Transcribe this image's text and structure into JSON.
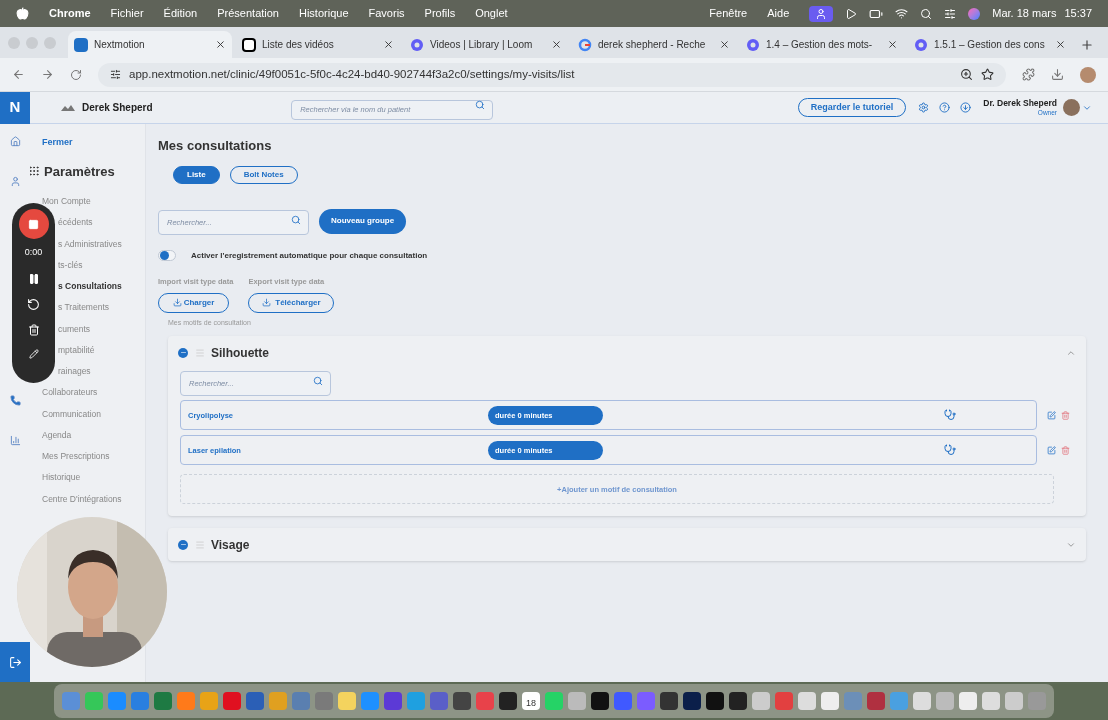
{
  "menu_bar": {
    "app": "Chrome",
    "items": [
      "Fichier",
      "Édition",
      "Présentation",
      "Historique",
      "Favoris",
      "Profils",
      "Onglet"
    ],
    "right_items": [
      "Fenêtre",
      "Aide"
    ],
    "date": "Mar. 18 mars",
    "time": "15:37"
  },
  "tabs": [
    {
      "title": "Nextmotion",
      "selected": true,
      "kind": "n"
    },
    {
      "title": "Liste des vidéos",
      "selected": false,
      "kind": "notion"
    },
    {
      "title": "Videos | Library | Loom",
      "selected": false,
      "kind": "loom"
    },
    {
      "title": "derek shepherd - Reche",
      "selected": false,
      "kind": "google"
    },
    {
      "title": "1.4 – Gestion des mots-",
      "selected": false,
      "kind": "loom"
    },
    {
      "title": "1.5.1 – Gestion des cons",
      "selected": false,
      "kind": "loom"
    }
  ],
  "address_bar": {
    "url": "app.nextmotion.net/clinic/49f0051c-5f0c-4c24-bd40-902744f3a2c0/settings/my-visits/list"
  },
  "app_header": {
    "logo": "N",
    "clinic": "Derek Sheperd",
    "search_placeholder": "Rechercher via le nom du patient",
    "tutorial_button": "Regarder le tutoriel",
    "user_name": "Dr. Derek Sheperd",
    "user_role": "Owner"
  },
  "sidebar": {
    "close": "Fermer",
    "title": "Paramètres",
    "items": [
      {
        "label": "Mon Compte",
        "selected": false
      },
      {
        "label": "écédents",
        "selected": false
      },
      {
        "label": "s Administratives",
        "selected": false
      },
      {
        "label": "ts-clés",
        "selected": false
      },
      {
        "label": "s Consultations",
        "selected": true
      },
      {
        "label": "s Traitements",
        "selected": false
      },
      {
        "label": "cuments",
        "selected": false
      },
      {
        "label": "mptabilité",
        "selected": false
      },
      {
        "label": "rainages",
        "selected": false
      },
      {
        "label": "Collaborateurs",
        "selected": false
      },
      {
        "label": "Communication",
        "selected": false
      },
      {
        "label": "Agenda",
        "selected": false
      },
      {
        "label": "Mes Prescriptions",
        "selected": false
      },
      {
        "label": "Historique",
        "selected": false
      },
      {
        "label": "Centre D'intégrations",
        "selected": false
      }
    ]
  },
  "recorder": {
    "time": "0:00"
  },
  "main": {
    "title": "Mes consultations",
    "view_tabs": [
      {
        "label": "Liste",
        "selected": true
      },
      {
        "label": "Bolt Notes",
        "selected": false
      }
    ],
    "search_placeholder": "Rechercher...",
    "new_group_button": "Nouveau groupe",
    "auto_record": {
      "label": "Activer l'eregistrement automatique pour chaque consultation",
      "on": false
    },
    "import_label": "Import visit type data",
    "export_label": "Export visit type data",
    "import_button": "Charger",
    "export_button": "Télécharger",
    "caption": "Mes motifs de consultation",
    "groups": [
      {
        "name": "Silhouette",
        "expanded": true,
        "search_placeholder": "Rechercher...",
        "motifs": [
          {
            "name": "Cryolipolyse",
            "duration": "durée 0 minutes"
          },
          {
            "name": "Laser epilation",
            "duration": "durée 0 minutes"
          }
        ],
        "add_link": "+Ajouter un motif de consultation"
      },
      {
        "name": "Visage",
        "expanded": false
      }
    ]
  },
  "dock": {
    "calendar_day": "18"
  }
}
